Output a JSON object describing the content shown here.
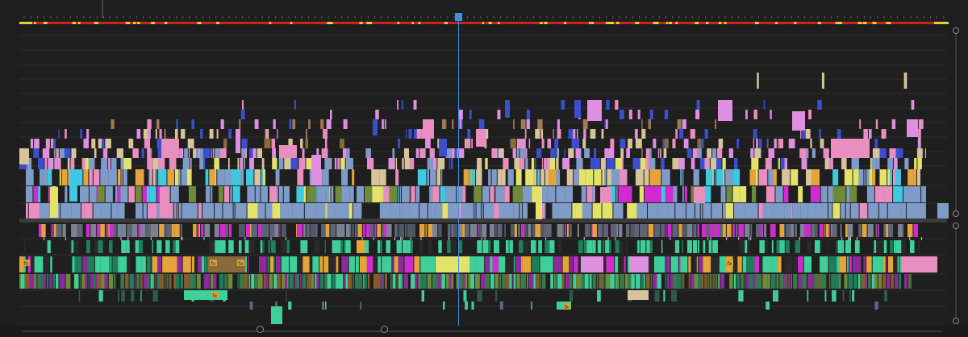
{
  "colors": {
    "background": "#1e1e1e",
    "work_area_red": "#c4281c",
    "work_area_yellow": "#e3d33a",
    "playhead": "#3f8fe8",
    "clip_blue": "#7f9cc9",
    "clip_pink": "#e88ec0",
    "clip_violet": "#df8fe0",
    "clip_yellow": "#e3e36c",
    "clip_magenta": "#d12ad1",
    "clip_tan": "#d8c49a",
    "clip_indigo": "#3a4fd0",
    "clip_orange": "#e5a43a",
    "clip_cyan": "#3fc9e0",
    "audio_mint": "#3fd09a",
    "audio_teal": "#1f7d5b",
    "audio_olive": "#6f8a3a",
    "audio_purple": "#8c2a9c",
    "gray_clip": "#5d6676"
  },
  "icons": {
    "playhead": "playhead-marker-icon",
    "fx_badge": "fx-badge-icon",
    "scroll_handle": "scroll-handle-icon"
  },
  "fx_labels": [
    "fx",
    "fx",
    "fx",
    "fx",
    "fx",
    "fx"
  ]
}
